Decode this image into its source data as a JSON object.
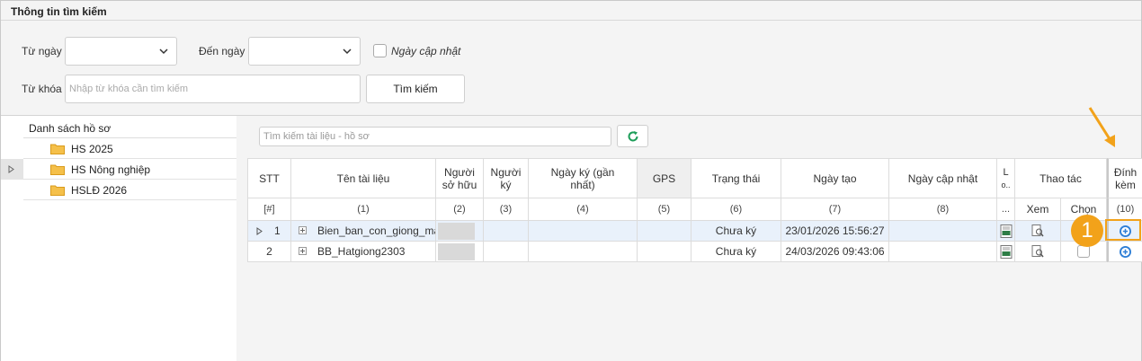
{
  "search_panel": {
    "title": "Thông tin tìm kiếm",
    "from_date_label": "Từ ngày",
    "to_date_label": "Đến ngày",
    "update_date_label": "Ngày cập nhật",
    "keyword_label": "Từ khóa",
    "keyword_placeholder": "Nhập từ khóa cần tìm kiếm",
    "search_button": "Tìm kiếm"
  },
  "tree": {
    "header": "Danh sách hồ sơ",
    "items": [
      {
        "label": "HS 2025"
      },
      {
        "label": "HS Nông nghiệp"
      },
      {
        "label": "HSLĐ 2026"
      }
    ]
  },
  "docs": {
    "search_placeholder": "Tìm kiếm tài liệu - hồ sơ",
    "columns": {
      "stt": "STT",
      "name": "Tên tài liệu",
      "owner": "Người sở hữu",
      "signer": "Người ký",
      "signed_date": "Ngày ký (gần nhất)",
      "gps": "GPS",
      "status": "Trạng thái",
      "created": "Ngày tạo",
      "updated": "Ngày cập nhật",
      "l": "L",
      "l2": "o..",
      "actions": "Thao tác",
      "attach": "Đính kèm",
      "view": "Xem",
      "choose": "Chọn"
    },
    "index_row": {
      "stt": "[#]",
      "name": "(1)",
      "owner": "(2)",
      "signer": "(3)",
      "signed_date": "(4)",
      "gps": "(5)",
      "status": "(6)",
      "created": "(7)",
      "updated": "(8)",
      "l": "...",
      "attach": "(10)"
    },
    "rows": [
      {
        "stt": "1",
        "name": "Bien_ban_con_giong_ma",
        "status": "Chưa ký",
        "created": "23/01/2026 15:56:27"
      },
      {
        "stt": "2",
        "name": "BB_Hatgiong2303",
        "status": "Chưa ký",
        "created": "24/03/2026 09:43:06"
      }
    ]
  },
  "annotation": {
    "badge": "1",
    "color": "#f2a21a"
  },
  "colors": {
    "accent": "#f2a21a",
    "refresh": "#1e9e5a",
    "attach_icon": "#2f7fd6"
  }
}
